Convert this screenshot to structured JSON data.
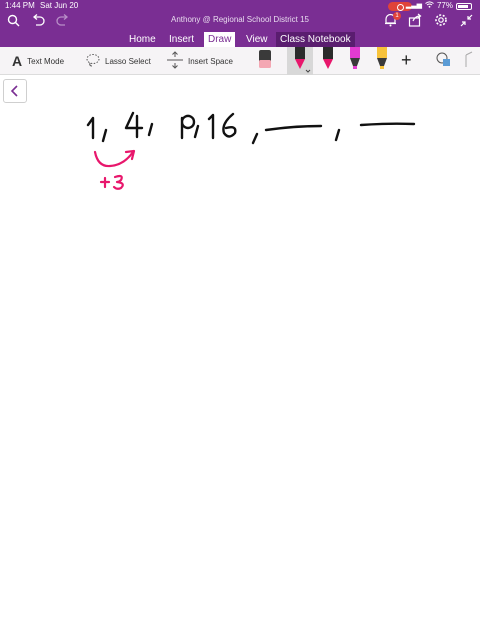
{
  "status_bar": {
    "time": "1:44 PM",
    "date": "Sat Jun 20",
    "battery": "77%"
  },
  "header": {
    "notebook_title": "Anthony @ Regional School District 15",
    "notification_count": "1"
  },
  "tabs": [
    {
      "label": "Home"
    },
    {
      "label": "Insert"
    },
    {
      "label": "Draw"
    },
    {
      "label": "View"
    },
    {
      "label": "Class Notebook"
    }
  ],
  "active_tab": "Draw",
  "ribbon": {
    "text_mode_glyph": "A",
    "text_mode_label": "Text Mode",
    "lasso_label": "Lasso Select",
    "insert_space_label": "Insert Space"
  },
  "pens": [
    {
      "name": "eraser",
      "color": "#f4a7b3"
    },
    {
      "name": "pen-pink",
      "color": "#e8176c",
      "selected": true
    },
    {
      "name": "pen-pink-2",
      "color": "#e8176c"
    },
    {
      "name": "highlighter-magenta",
      "color": "#e33bd1"
    },
    {
      "name": "highlighter-yellow",
      "color": "#f7c23a"
    }
  ],
  "colors": {
    "brand": "#7a2e93",
    "ink_black": "#111111",
    "ink_pink": "#e8176c"
  },
  "canvas": {
    "handwriting": "1, 4, 9, 16, ___, ___",
    "annotation": "+3"
  }
}
